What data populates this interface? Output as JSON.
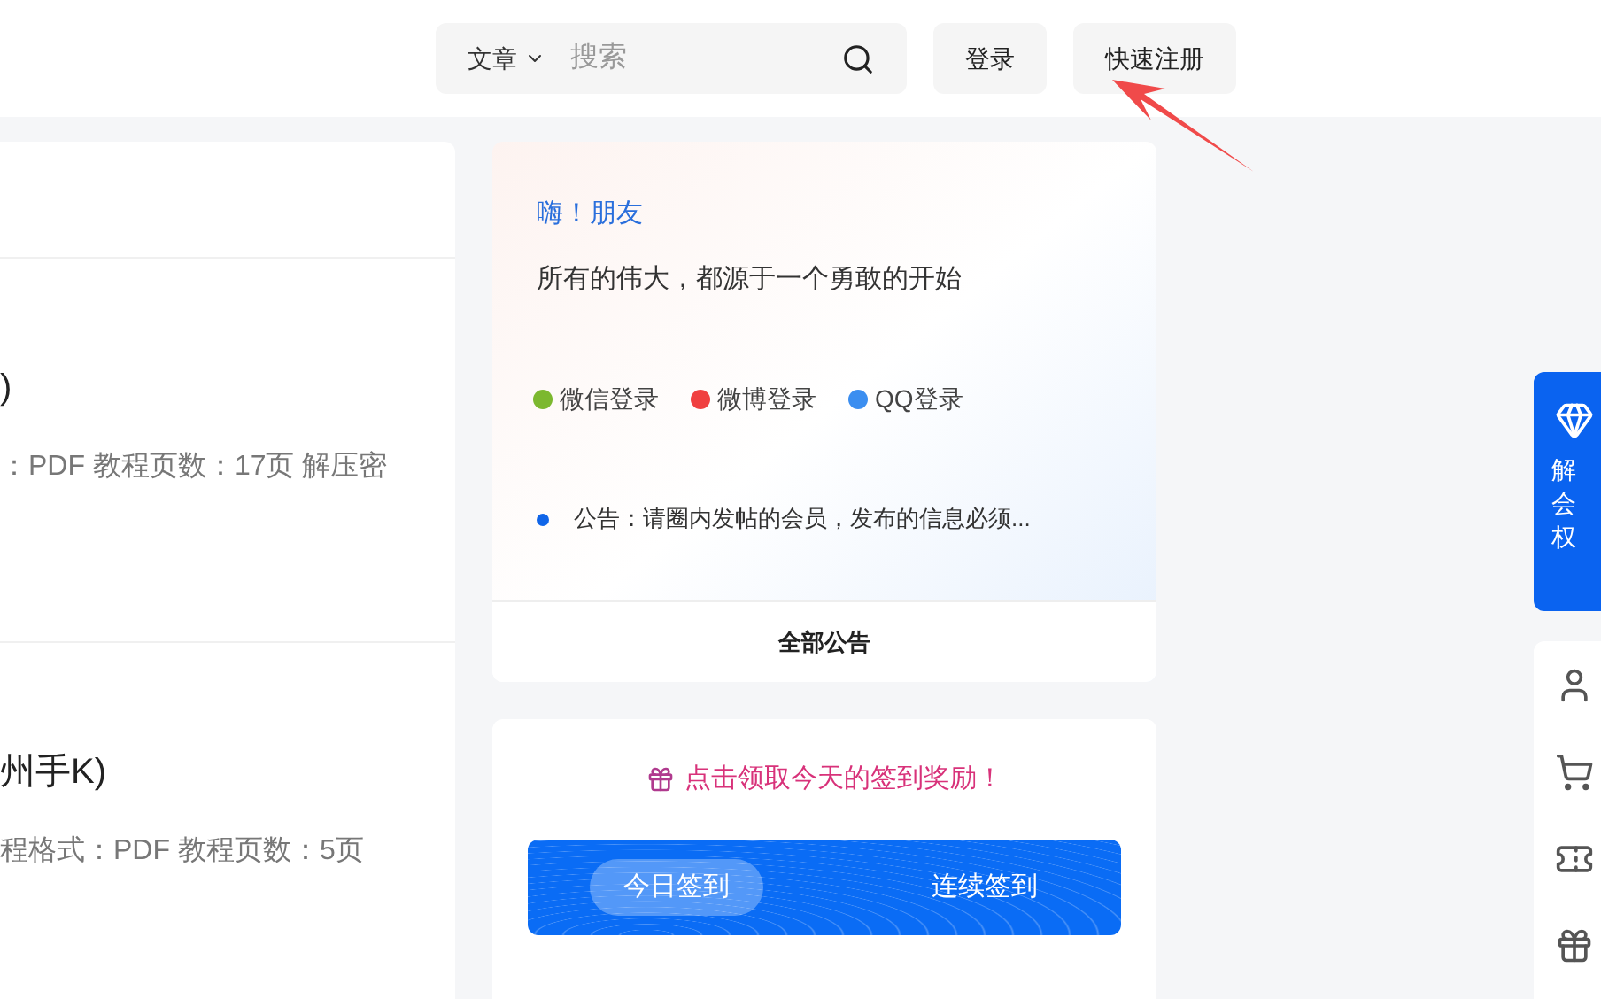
{
  "header": {
    "search": {
      "category": "文章",
      "placeholder": "搜索"
    },
    "buttons": [
      {
        "label": "登录"
      },
      {
        "label": "快速注册"
      }
    ]
  },
  "posts": [
    {
      "title": ")",
      "meta": "：PDF 教程页数：17页 解压密"
    },
    {
      "title": "州手K)",
      "meta": "程格式：PDF 教程页数：5页"
    }
  ],
  "welcome": {
    "greeting": "嗨！朋友",
    "motto": "所有的伟大，都源于一个勇敢的开始",
    "logins": [
      {
        "label": "微信登录",
        "color": "#7cb82f"
      },
      {
        "label": "微博登录",
        "color": "#f04040"
      },
      {
        "label": "QQ登录",
        "color": "#3b8ef0"
      }
    ],
    "notice": "公告：请圈内发帖的会员，发布的信息必须...",
    "all_notices": "全部公告"
  },
  "checkin": {
    "prompt": "点击领取今天的签到奖励！",
    "tabs": [
      {
        "label": "今日签到",
        "selected": true
      },
      {
        "label": "连续签到",
        "selected": false
      }
    ]
  },
  "side": {
    "vip_lines": [
      "解",
      "会",
      "权"
    ]
  }
}
